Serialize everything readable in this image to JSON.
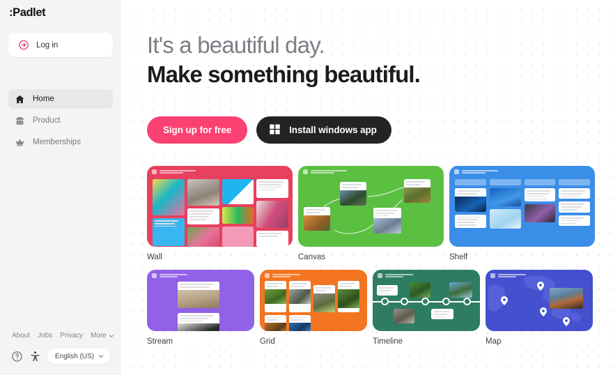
{
  "sidebar": {
    "brand": ":Padlet",
    "login": {
      "label": "Log in",
      "icon": "arrow-circle-right-icon"
    },
    "nav": [
      {
        "label": "Home",
        "icon": "home-icon",
        "active": true
      },
      {
        "label": "Product",
        "icon": "kiosk-icon",
        "active": false
      },
      {
        "label": "Memberships",
        "icon": "crown-icon",
        "active": false
      }
    ],
    "footer_links": [
      {
        "label": "About"
      },
      {
        "label": "Jobs"
      },
      {
        "label": "Privacy"
      },
      {
        "label": "More",
        "icon": "chevron-down-icon"
      }
    ],
    "footer_bar": {
      "help_icon": "question-circle-icon",
      "accessibility_icon": "accessibility-icon",
      "language": "English (US)",
      "language_chevron": "chevron-down-icon"
    }
  },
  "main": {
    "heading_line1": "It's a beautiful day.",
    "heading_line2": "Make something beautiful.",
    "cta": {
      "signup_label": "Sign up for free",
      "install_label": "Install windows app",
      "install_icon": "windows-logo-icon",
      "signup_color": "#fb4072",
      "install_color": "#232326"
    },
    "templates_row1": [
      {
        "label": "Wall",
        "color": "#e8405f"
      },
      {
        "label": "Canvas",
        "color": "#5bbf42"
      },
      {
        "label": "Shelf",
        "color": "#3b8ee8"
      }
    ],
    "templates_row2": [
      {
        "label": "Stream",
        "color": "#9161e8"
      },
      {
        "label": "Grid",
        "color": "#f47521"
      },
      {
        "label": "Timeline",
        "color": "#2e7d63"
      },
      {
        "label": "Map",
        "color": "#4450ce"
      }
    ]
  }
}
